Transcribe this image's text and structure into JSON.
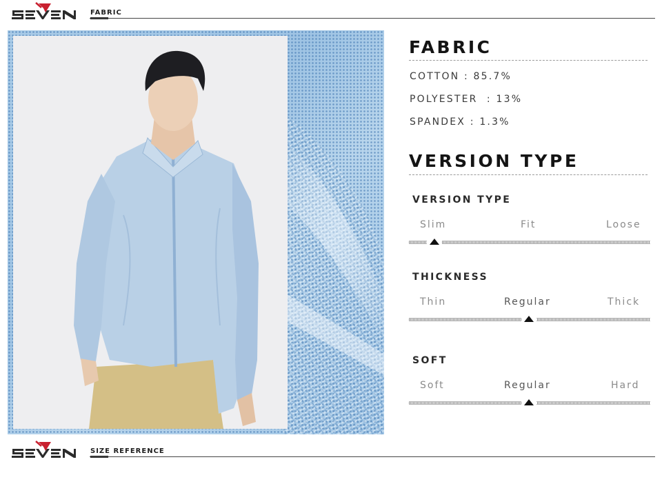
{
  "header": {
    "brand": "SEVEN",
    "section_tag": "FABRIC"
  },
  "footer": {
    "brand": "SEVEN",
    "section_tag": "SIZE REFERENCE"
  },
  "fabric": {
    "title": "FABRIC",
    "composition": [
      "COTTON : 85.7%",
      "POLYESTER  : 13%",
      "SPANDEX : 1.3%"
    ]
  },
  "version": {
    "title": "VERSION TYPE",
    "scales": [
      {
        "name": "VERSION TYPE",
        "options": [
          "Slim",
          "Fit",
          "Loose"
        ],
        "selected": "Slim",
        "selected_index": 0
      },
      {
        "name": "THICKNESS",
        "options": [
          "Thin",
          "Regular",
          "Thick"
        ],
        "selected": "Regular",
        "selected_index": 1
      },
      {
        "name": "SOFT",
        "options": [
          "Soft",
          "Regular",
          "Hard"
        ],
        "selected": "Regular",
        "selected_index": 1
      }
    ]
  },
  "colors": {
    "brand_red": "#c8202f",
    "shirt_blue": "#a9c9e6",
    "text_dark": "#141414"
  },
  "icons": {
    "logo": "seven-logo-icon",
    "pointer": "triangle-up-icon"
  }
}
